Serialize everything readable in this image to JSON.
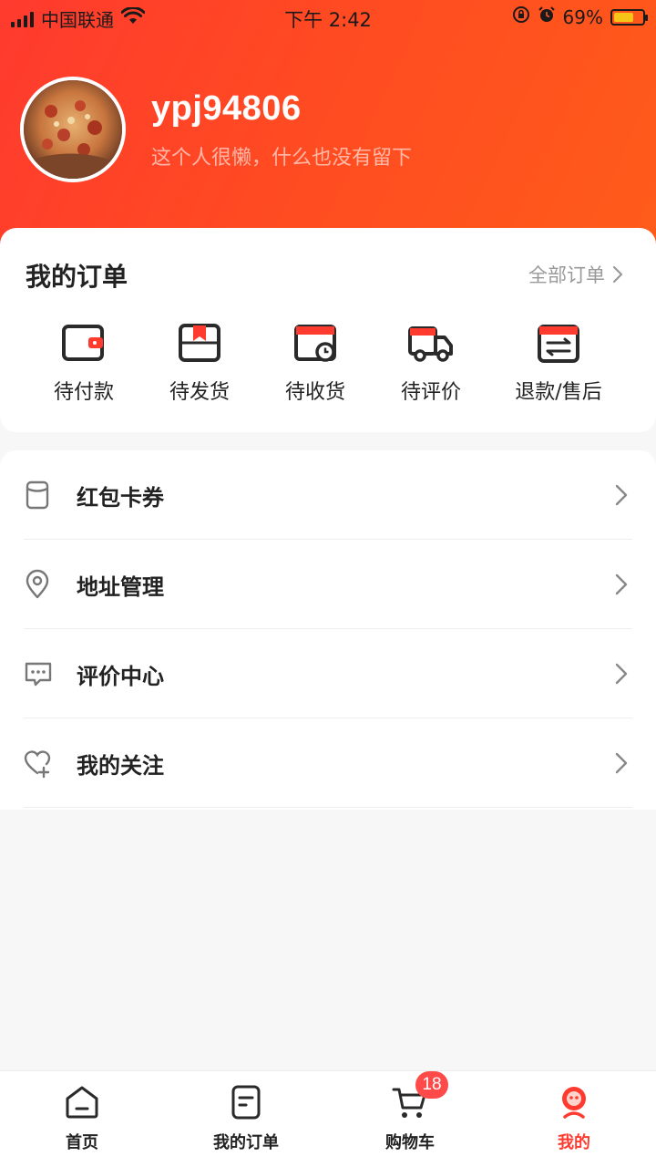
{
  "status_bar": {
    "carrier": "中国联通",
    "time": "下午 2:42",
    "battery_percent": "69%",
    "battery_level": 0.69
  },
  "profile": {
    "username": "ypj94806",
    "bio": "这个人很懒，什么也没有留下"
  },
  "orders": {
    "title": "我的订单",
    "all_link": "全部订单",
    "items": [
      {
        "label": "待付款",
        "icon": "wallet-icon"
      },
      {
        "label": "待发货",
        "icon": "package-icon"
      },
      {
        "label": "待收货",
        "icon": "receive-clock-icon"
      },
      {
        "label": "待评价",
        "icon": "truck-icon"
      },
      {
        "label": "退款/售后",
        "icon": "refund-card-icon"
      }
    ]
  },
  "menu": {
    "items": [
      {
        "label": "红包卡券",
        "icon": "coupon-icon"
      },
      {
        "label": "地址管理",
        "icon": "location-pin-icon"
      },
      {
        "label": "评价中心",
        "icon": "chat-bubble-icon"
      },
      {
        "label": "我的关注",
        "icon": "heart-plus-icon"
      }
    ]
  },
  "tabbar": {
    "items": [
      {
        "label": "首页",
        "icon": "home-icon"
      },
      {
        "label": "我的订单",
        "icon": "order-list-icon"
      },
      {
        "label": "购物车",
        "icon": "cart-icon",
        "badge": "18"
      },
      {
        "label": "我的",
        "icon": "user-mascot-icon",
        "active": true
      }
    ]
  },
  "colors": {
    "accent": "#ff3b30",
    "header_gradient_start": "#ff3a2e",
    "header_gradient_end": "#ff5c1a",
    "badge": "#ff4a4a"
  }
}
